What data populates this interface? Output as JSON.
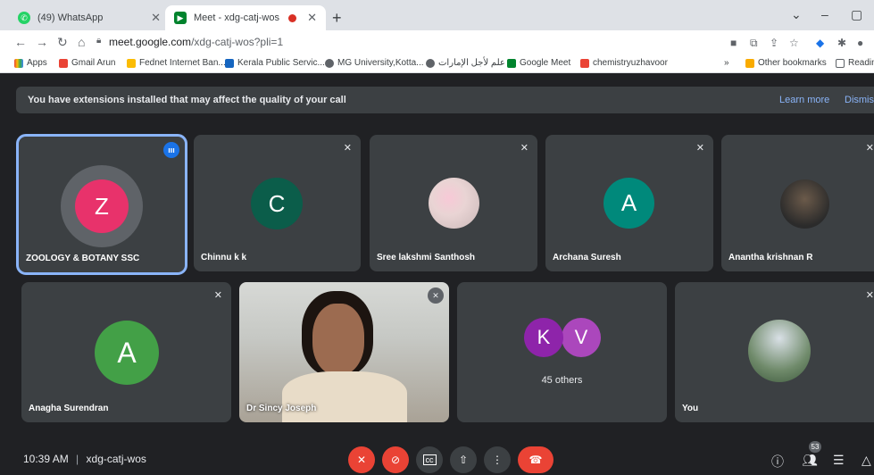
{
  "browser": {
    "tabs": [
      {
        "title": "(49) WhatsApp",
        "close": "✕"
      },
      {
        "title": "Meet - xdg-catj-wos",
        "close": "✕"
      }
    ],
    "new_tab": "+",
    "window_controls": [
      "⌄",
      "–",
      "▢"
    ],
    "address": {
      "host": "meet.google.com",
      "path": "/xdg-catj-wos?pli=1"
    },
    "bookmarks": [
      "Apps",
      "Gmail Arun",
      "Fednet Internet Ban...",
      "Kerala Public Servic...",
      "MG University,Kotta...",
      "علم لأجل الإمارات",
      "Google Meet",
      "chemistryuzhavoor"
    ],
    "bookmarks_more": "»",
    "other_bookmarks": "Other bookmarks",
    "reading_list": "Readin"
  },
  "meet": {
    "banner": {
      "text": "You have extensions installed that may affect the quality of your call",
      "learn_more": "Learn more",
      "dismiss": "Dismis"
    },
    "participants": [
      {
        "name": "ZOOLOGY & BOTANY SSC",
        "initial": "Z",
        "color": "#e8326b"
      },
      {
        "name": "Chinnu k k",
        "initial": "C",
        "color": "#0b5d4a"
      },
      {
        "name": "Sree lakshmi Santhosh",
        "initial": "",
        "color": "#e9d4d4"
      },
      {
        "name": "Archana Suresh",
        "initial": "A",
        "color": "#00897b"
      },
      {
        "name": "Anantha krishnan R",
        "initial": "",
        "color": "#2b2b2b"
      },
      {
        "name": "Anagha Surendran",
        "initial": "A",
        "color": "#43a047"
      },
      {
        "name": "Dr Sincy Joseph",
        "initial": "",
        "color": "#9aa0a6"
      },
      {
        "name": "",
        "initial": "",
        "color": ""
      },
      {
        "name": "You",
        "initial": "",
        "color": "#4a6b4a"
      }
    ],
    "others": {
      "initials": [
        "K",
        "V"
      ],
      "colors": [
        "#8e24aa",
        "#ab47bc"
      ],
      "label": "45 others"
    },
    "time": "10:39 AM",
    "separator": "|",
    "meeting_code": "xdg-catj-wos",
    "people_count": "53"
  }
}
